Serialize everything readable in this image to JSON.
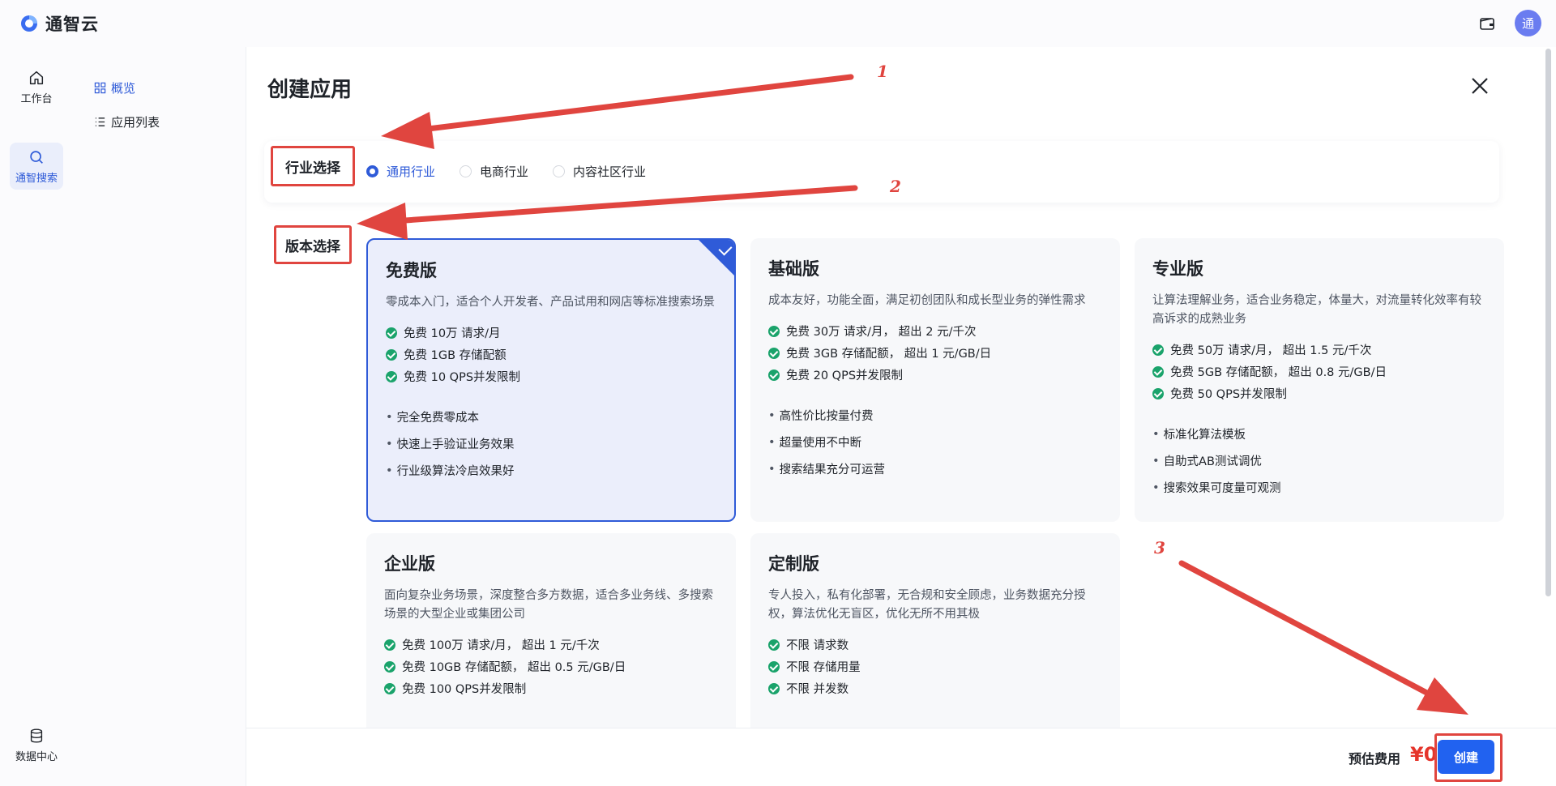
{
  "header": {
    "brand": "通智云",
    "avatar_text": "通"
  },
  "rail": {
    "items": [
      {
        "label": "工作台",
        "icon": "home-icon"
      },
      {
        "label": "通智搜索",
        "icon": "search-icon"
      },
      {
        "label": "数据中心",
        "icon": "database-icon"
      }
    ]
  },
  "subnav": {
    "items": [
      {
        "label": "概览",
        "icon": "grid-icon"
      },
      {
        "label": "应用列表",
        "icon": "list-icon"
      }
    ]
  },
  "main": {
    "title": "创建应用",
    "industry": {
      "label": "行业选择",
      "options": [
        "通用行业",
        "电商行业",
        "内容社区行业"
      ],
      "selected": "通用行业"
    },
    "version_label": "版本选择",
    "plans": [
      {
        "name": "免费版",
        "desc": "零成本入门，适合个人开发者、产品试用和网店等标准搜索场景",
        "features": [
          "免费 10万 请求/月",
          "免费 1GB 存储配额",
          "免费 10 QPS并发限制"
        ],
        "bullets": [
          "完全免费零成本",
          "快速上手验证业务效果",
          "行业级算法冷启效果好"
        ]
      },
      {
        "name": "基础版",
        "desc": "成本友好，功能全面，满足初创团队和成长型业务的弹性需求",
        "features": [
          "免费 30万 请求/月， 超出 2 元/千次",
          "免费 3GB 存储配额， 超出 1 元/GB/日",
          "免费 20 QPS并发限制"
        ],
        "bullets": [
          "高性价比按量付费",
          "超量使用不中断",
          "搜索结果充分可运营"
        ]
      },
      {
        "name": "专业版",
        "desc": "让算法理解业务，适合业务稳定，体量大，对流量转化效率有较高诉求的成熟业务",
        "features": [
          "免费 50万 请求/月， 超出 1.5 元/千次",
          "免费 5GB 存储配额， 超出 0.8 元/GB/日",
          "免费 50 QPS并发限制"
        ],
        "bullets": [
          "标准化算法模板",
          "自助式AB测试调优",
          "搜索效果可度量可观测"
        ]
      },
      {
        "name": "企业版",
        "desc": "面向复杂业务场景，深度整合多方数据，适合多业务线、多搜索场景的大型企业或集团公司",
        "features": [
          "免费 100万 请求/月， 超出 1 元/千次",
          "免费 10GB 存储配额， 超出 0.5 元/GB/日",
          "免费 100 QPS并发限制"
        ],
        "bullets": []
      },
      {
        "name": "定制版",
        "desc": "专人投入，私有化部署，无合规和安全顾虑，业务数据充分授权，算法优化无盲区，优化无所不用其极",
        "features": [
          "不限 请求数",
          "不限 存储用量",
          "不限 并发数"
        ],
        "bullets": []
      }
    ],
    "selected_plan": "免费版"
  },
  "footer": {
    "cost_label": "预估费用",
    "cost_value": "¥0",
    "create_label": "创建"
  },
  "annotations": [
    "1",
    "2",
    "3"
  ],
  "colors": {
    "accent": "#2f5bd8",
    "button": "#2162f0",
    "annotation": "#e0453f",
    "success": "#1aa36b"
  }
}
